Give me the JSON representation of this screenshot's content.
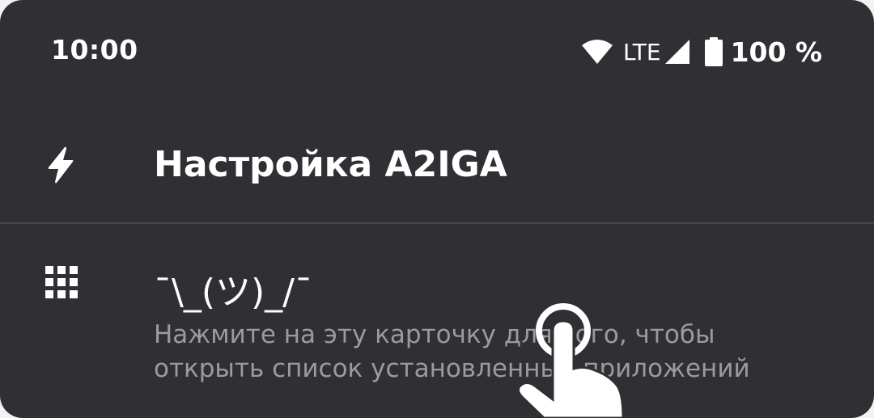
{
  "status_bar": {
    "time": "10:00",
    "network": "LTE",
    "battery": "100 %"
  },
  "tiles": [
    {
      "icon": "flash-icon",
      "title": "Настройка A2IGA"
    },
    {
      "icon": "apps-grid-icon",
      "title": "¯\\_(ツ)_/¯",
      "subtitle": "Нажмите на эту карточку для того, чтобы открыть список установленных приложений"
    }
  ],
  "overlay": {
    "icon": "tap-hand-icon"
  },
  "colors": {
    "card_background": "#303034",
    "divider": "#46464b",
    "text_primary": "#ffffff",
    "text_secondary": "#9a9aa0"
  }
}
